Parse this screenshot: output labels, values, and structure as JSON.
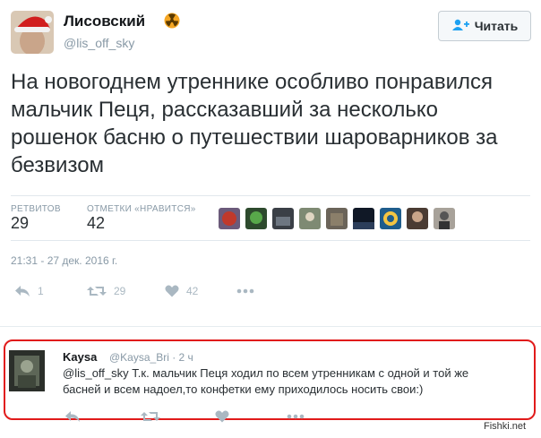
{
  "tweet": {
    "author_name": "Лисовский",
    "author_handle": "@lis_off_sky",
    "follow_label": "Читать",
    "text": "На новогоднем утреннике особливо понравился мальчик Пеця, рассказавший за несколько рошенок басню о путешествии шароварников за безвизом",
    "retweets_label": "РЕТВИТОВ",
    "retweets_count": "29",
    "likes_label": "ОТМЕТКИ «НРАВИТСЯ»",
    "likes_count": "42",
    "timestamp": "21:31 - 27 дек. 2016 г.",
    "actions": {
      "reply_count": "1",
      "retweet_count": "29",
      "like_count": "42"
    }
  },
  "reply": {
    "author_name": "Kaysa",
    "author_handle": "@Kaysa_Bri",
    "time": "· 2 ч",
    "mention": "@lis_off_sky",
    "text_line1": " Т.к. мальчик Пеця ходил по всем утренникам с одной и той же",
    "text_line2": "басней и  всем надоел,то конфетки ему приходилось носить свои:)"
  },
  "watermark": "Fishki.net",
  "colors": {
    "accent": "#e11b1b",
    "muted": "#8899a6",
    "badge": "#f5a623"
  },
  "icons": [
    "avatar-santa",
    "radiation-badge-icon",
    "follow-user-icon",
    "reply-icon",
    "retweet-icon",
    "heart-icon",
    "more-icon"
  ]
}
